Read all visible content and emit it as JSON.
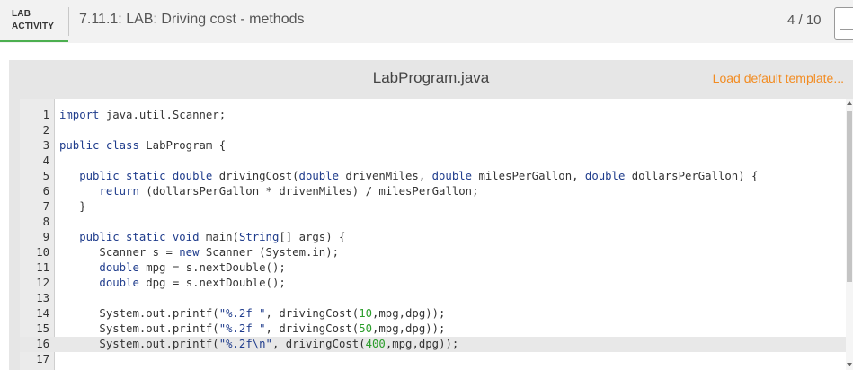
{
  "header": {
    "tag_line1": "LAB",
    "tag_line2": "ACTIVITY",
    "title": "7.11.1: LAB: Driving cost - methods",
    "score": "4 / 10"
  },
  "editor": {
    "filename": "LabProgram.java",
    "load_default": "Load default template...",
    "active_line": 16,
    "lines": [
      {
        "n": "1",
        "code": "import java.util.Scanner;"
      },
      {
        "n": "2",
        "code": ""
      },
      {
        "n": "3",
        "code": "public class LabProgram {"
      },
      {
        "n": "4",
        "code": ""
      },
      {
        "n": "5",
        "code": "   public static double drivingCost(double drivenMiles, double milesPerGallon, double dollarsPerGallon) {"
      },
      {
        "n": "6",
        "code": "      return (dollarsPerGallon * drivenMiles) / milesPerGallon;"
      },
      {
        "n": "7",
        "code": "   }"
      },
      {
        "n": "8",
        "code": ""
      },
      {
        "n": "9",
        "code": "   public static void main(String[] args) {"
      },
      {
        "n": "10",
        "code": "      Scanner s = new Scanner (System.in);"
      },
      {
        "n": "11",
        "code": "      double mpg = s.nextDouble();"
      },
      {
        "n": "12",
        "code": "      double dpg = s.nextDouble();"
      },
      {
        "n": "13",
        "code": ""
      },
      {
        "n": "14",
        "code": "      System.out.printf(\"%.2f \", drivingCost(10,mpg,dpg));"
      },
      {
        "n": "15",
        "code": "      System.out.printf(\"%.2f \", drivingCost(50,mpg,dpg));"
      },
      {
        "n": "16",
        "code": "      System.out.printf(\"%.2f\\n\", drivingCost(400,mpg,dpg));"
      },
      {
        "n": "17",
        "code": ""
      }
    ]
  },
  "colors": {
    "accent_green": "#4caf50",
    "link_orange": "#f28c22",
    "keyword_blue": "#1f3c8c",
    "number_green": "#2a9d2a"
  }
}
